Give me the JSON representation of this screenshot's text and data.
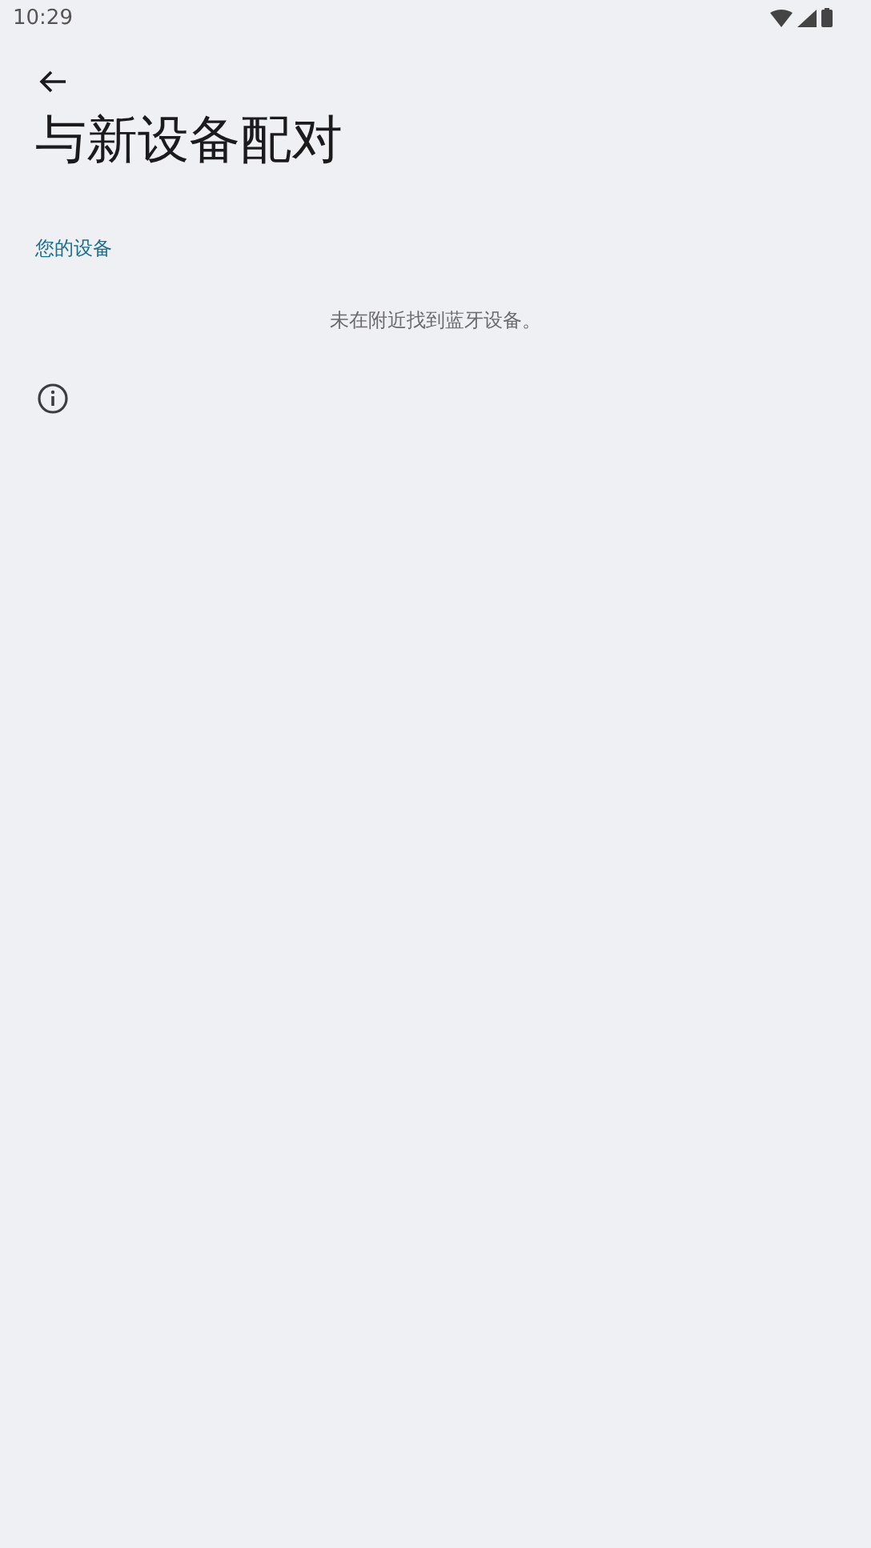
{
  "status_bar": {
    "time": "10:29"
  },
  "title": "与新设备配对",
  "section": {
    "header": "您的设备",
    "empty_message": "未在附近找到蓝牙设备。"
  }
}
